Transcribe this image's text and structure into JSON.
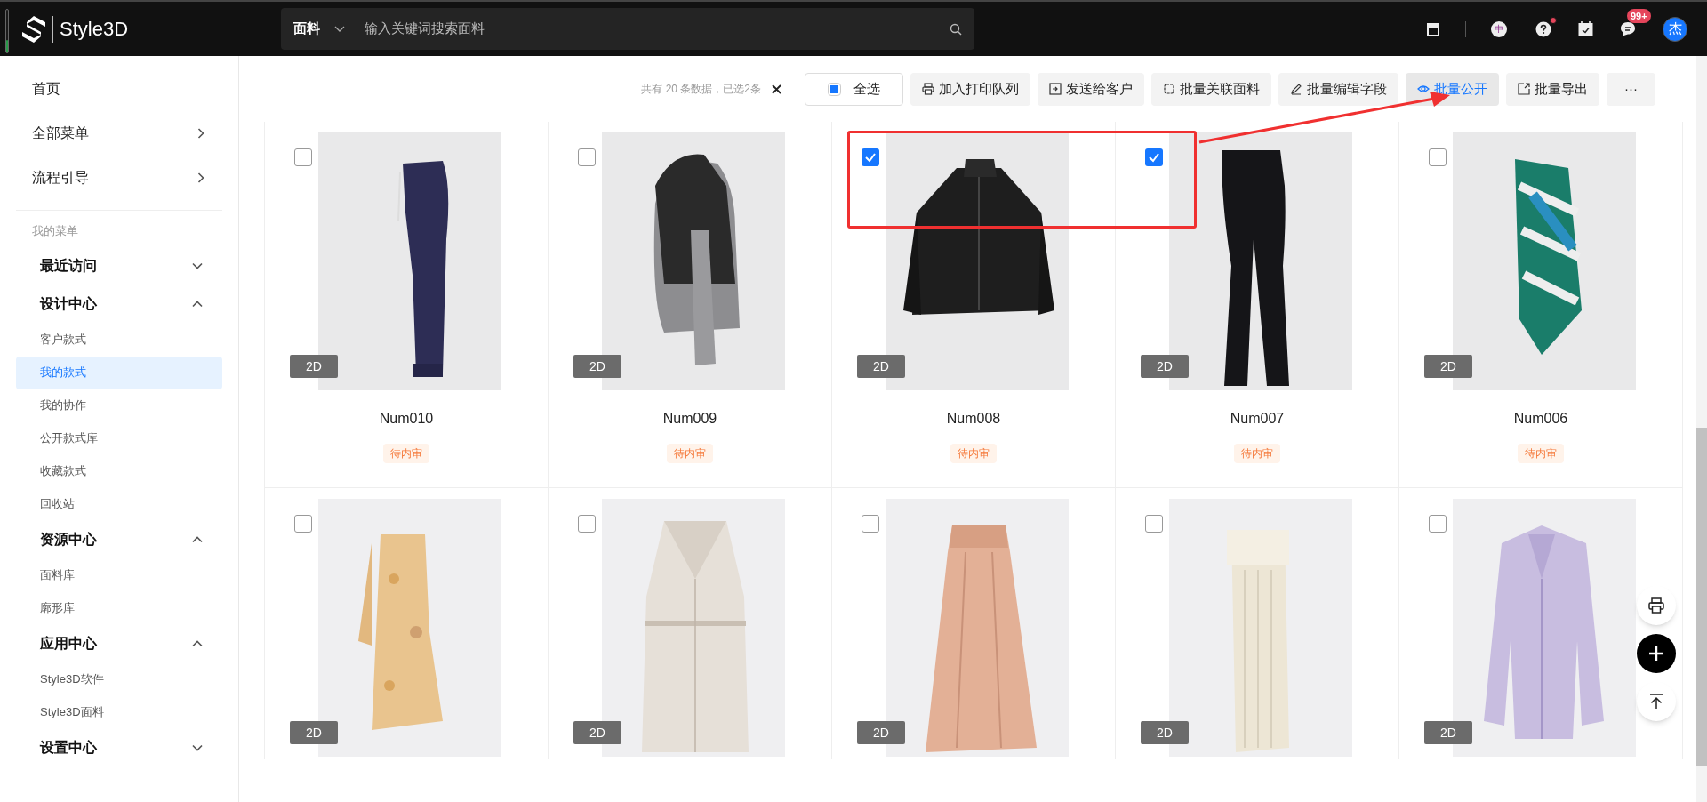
{
  "header": {
    "logo": "Style3D",
    "search": {
      "category": "面料",
      "placeholder": "输入关键词搜索面料"
    },
    "language": "中",
    "help_has_dot": true,
    "messages_badge": "99+",
    "avatar": "杰"
  },
  "sidebar": {
    "top_items": [
      {
        "label": "首页",
        "kind": "link"
      },
      {
        "label": "全部菜单",
        "kind": "submenu"
      },
      {
        "label": "流程引导",
        "kind": "submenu"
      }
    ],
    "section_label": "我的菜单",
    "groups": [
      {
        "label": "最近访问",
        "expanded": false
      },
      {
        "label": "设计中心",
        "expanded": true,
        "items": [
          {
            "label": "客户款式",
            "selected": false
          },
          {
            "label": "我的款式",
            "selected": true
          },
          {
            "label": "我的协作",
            "selected": false
          },
          {
            "label": "公开款式库",
            "selected": false
          },
          {
            "label": "收藏款式",
            "selected": false
          },
          {
            "label": "回收站",
            "selected": false
          }
        ]
      },
      {
        "label": "资源中心",
        "expanded": true,
        "items": [
          {
            "label": "面料库",
            "selected": false
          },
          {
            "label": "廓形库",
            "selected": false
          }
        ]
      },
      {
        "label": "应用中心",
        "expanded": true,
        "items": [
          {
            "label": "Style3D软件",
            "selected": false
          },
          {
            "label": "Style3D面料",
            "selected": false
          }
        ]
      },
      {
        "label": "设置中心",
        "expanded": false
      }
    ]
  },
  "toolbar": {
    "summary": "共有 20 条数据，已选2条",
    "select_all": {
      "label": "全选",
      "indeterminate": true
    },
    "buttons": [
      {
        "label": "加入打印队列",
        "selected": false
      },
      {
        "label": "发送给客户",
        "selected": false
      },
      {
        "label": "批量关联面料",
        "selected": false
      },
      {
        "label": "批量编辑字段",
        "selected": false
      },
      {
        "label": "批量公开",
        "selected": true
      },
      {
        "label": "批量导出",
        "selected": false
      },
      {
        "label": "···",
        "selected": false
      }
    ]
  },
  "cards": [
    {
      "name": "Num010",
      "status": "待内审",
      "badge": "2D",
      "checked": false
    },
    {
      "name": "Num009",
      "status": "待内审",
      "badge": "2D",
      "checked": false
    },
    {
      "name": "Num008",
      "status": "待内审",
      "badge": "2D",
      "checked": true
    },
    {
      "name": "Num007",
      "status": "待内审",
      "badge": "2D",
      "checked": true
    },
    {
      "name": "Num006",
      "status": "待内审",
      "badge": "2D",
      "checked": false
    },
    {
      "badge": "2D",
      "checked": false
    },
    {
      "badge": "2D",
      "checked": false
    },
    {
      "badge": "2D",
      "checked": false
    },
    {
      "badge": "2D",
      "checked": false
    },
    {
      "badge": "2D",
      "checked": false
    }
  ]
}
